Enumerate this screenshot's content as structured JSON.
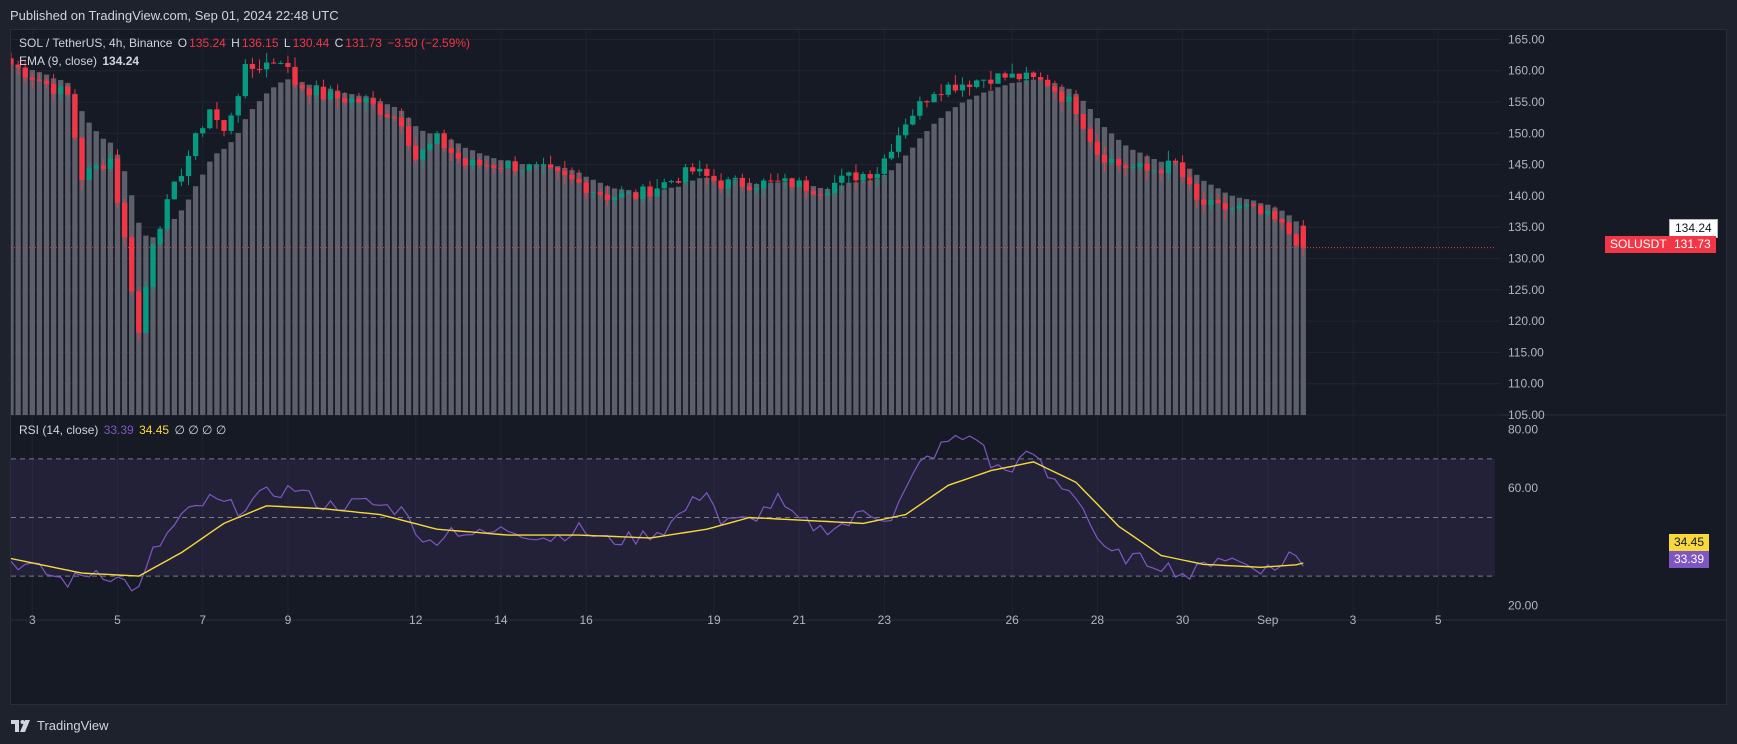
{
  "header": {
    "published": "Published on TradingView.com, Sep 01, 2024 22:48 UTC"
  },
  "footer": {
    "brand": "TradingView"
  },
  "legend": {
    "symbol": "SOL / TetherUS, 4h, Binance",
    "o_label": "O",
    "o_value": "135.24",
    "h_label": "H",
    "h_value": "136.15",
    "l_label": "L",
    "l_value": "130.44",
    "c_label": "C",
    "c_value": "131.73",
    "change": "−3.50 (−2.59%)",
    "ema_label": "EMA (9, close)",
    "ema_value": "134.24",
    "rsi_label": "RSI (14, close)",
    "rsi_value": "33.39",
    "rsi_ma_value": "34.45",
    "rsi_extra": "∅ ∅ ∅ ∅"
  },
  "price_labels": {
    "ema_box": "134.24",
    "symbol_box": "SOLUSDT",
    "last_price_box": "131.73",
    "rsi_ma_box": "34.45",
    "rsi_box": "33.39"
  },
  "colors": {
    "up": "#089981",
    "down": "#f23645",
    "ema_hist": "#5d606b",
    "rsi": "#7e57c2",
    "rsi_ma": "#f7d93d",
    "background": "#161a25"
  },
  "chart_data": [
    {
      "type": "candlestick",
      "title": "SOL / TetherUS, 4h, Binance",
      "y_ticks": [
        "165.00",
        "160.00",
        "155.00",
        "150.00",
        "145.00",
        "140.00",
        "135.00",
        "130.00",
        "125.00",
        "120.00",
        "115.00",
        "110.00",
        "105.00"
      ],
      "ylim": [
        105,
        166.5
      ],
      "x_tick_labels": [
        "3",
        "5",
        "7",
        "9",
        "12",
        "14",
        "16",
        "19",
        "21",
        "23",
        "26",
        "28",
        "30",
        "Sep",
        "3",
        "5"
      ],
      "x_tick_index": [
        3,
        15,
        27,
        39,
        57,
        69,
        81,
        99,
        111,
        123,
        141,
        153,
        165,
        177,
        189,
        201
      ],
      "x_label_index_range": [
        0,
        209
      ],
      "candle_count": 183,
      "ohlc_anchors": [
        [
          0,
          161
        ],
        [
          8,
          156
        ],
        [
          10,
          143
        ],
        [
          14,
          146
        ],
        [
          16,
          133
        ],
        [
          18,
          118
        ],
        [
          20,
          133
        ],
        [
          24,
          144
        ],
        [
          28,
          154
        ],
        [
          30,
          150
        ],
        [
          33,
          160
        ],
        [
          38,
          162
        ],
        [
          40,
          158
        ],
        [
          44,
          156
        ],
        [
          50,
          155
        ],
        [
          55,
          152
        ],
        [
          57,
          146
        ],
        [
          60,
          149
        ],
        [
          64,
          145
        ],
        [
          70,
          145
        ],
        [
          75,
          144
        ],
        [
          80,
          142
        ],
        [
          84,
          140
        ],
        [
          88,
          140
        ],
        [
          92,
          142
        ],
        [
          96,
          144
        ],
        [
          100,
          142
        ],
        [
          104,
          142
        ],
        [
          110,
          142
        ],
        [
          114,
          141
        ],
        [
          118,
          143
        ],
        [
          122,
          144
        ],
        [
          126,
          152
        ],
        [
          130,
          157
        ],
        [
          134,
          158
        ],
        [
          138,
          159
        ],
        [
          142,
          159
        ],
        [
          146,
          158
        ],
        [
          150,
          154
        ],
        [
          153,
          147
        ],
        [
          156,
          145
        ],
        [
          160,
          144
        ],
        [
          164,
          145
        ],
        [
          167,
          139
        ],
        [
          170,
          138
        ],
        [
          174,
          138
        ],
        [
          178,
          136
        ],
        [
          182,
          132
        ]
      ],
      "last": {
        "open": 135.24,
        "high": 136.15,
        "low": 130.44,
        "close": 131.73
      },
      "series": [
        {
          "name": "EMA (9, close)",
          "style": "histogram",
          "last_value": 134.24
        }
      ]
    },
    {
      "type": "line",
      "title": "RSI (14, close)",
      "y_ticks": [
        "80.00",
        "60.00",
        "20.00"
      ],
      "ylim": [
        15,
        85
      ],
      "bands": [
        70,
        50,
        30
      ],
      "series": [
        {
          "name": "RSI",
          "last_value": 33.39,
          "anchors": [
            [
              0,
              35
            ],
            [
              4,
              32
            ],
            [
              8,
              28
            ],
            [
              12,
              32
            ],
            [
              16,
              28
            ],
            [
              18,
              25
            ],
            [
              20,
              38
            ],
            [
              24,
              50
            ],
            [
              28,
              56
            ],
            [
              32,
              53
            ],
            [
              36,
              58
            ],
            [
              40,
              60
            ],
            [
              44,
              54
            ],
            [
              50,
              55
            ],
            [
              56,
              52
            ],
            [
              58,
              40
            ],
            [
              62,
              46
            ],
            [
              66,
              44
            ],
            [
              70,
              46
            ],
            [
              76,
              43
            ],
            [
              80,
              46
            ],
            [
              84,
              42
            ],
            [
              88,
              43
            ],
            [
              92,
              46
            ],
            [
              96,
              55
            ],
            [
              98,
              60
            ],
            [
              100,
              48
            ],
            [
              104,
              49
            ],
            [
              108,
              56
            ],
            [
              110,
              50
            ],
            [
              114,
              46
            ],
            [
              118,
              48
            ],
            [
              120,
              52
            ],
            [
              124,
              50
            ],
            [
              128,
              68
            ],
            [
              132,
              76
            ],
            [
              136,
              78
            ],
            [
              138,
              68
            ],
            [
              140,
              66
            ],
            [
              144,
              72
            ],
            [
              146,
              64
            ],
            [
              150,
              58
            ],
            [
              152,
              48
            ],
            [
              154,
              38
            ],
            [
              158,
              36
            ],
            [
              162,
              34
            ],
            [
              166,
              30
            ],
            [
              170,
              37
            ],
            [
              174,
              34
            ],
            [
              178,
              32
            ],
            [
              180,
              38
            ],
            [
              182,
              34
            ]
          ]
        },
        {
          "name": "RSI-based MA",
          "last_value": 34.45,
          "anchors": [
            [
              0,
              36
            ],
            [
              10,
              31
            ],
            [
              18,
              30
            ],
            [
              24,
              38
            ],
            [
              30,
              48
            ],
            [
              36,
              54
            ],
            [
              44,
              53
            ],
            [
              52,
              51
            ],
            [
              60,
              46
            ],
            [
              70,
              44
            ],
            [
              80,
              44
            ],
            [
              90,
              43
            ],
            [
              98,
              46
            ],
            [
              104,
              50
            ],
            [
              112,
              49
            ],
            [
              120,
              48
            ],
            [
              126,
              51
            ],
            [
              132,
              61
            ],
            [
              138,
              66
            ],
            [
              144,
              69
            ],
            [
              150,
              62
            ],
            [
              156,
              47
            ],
            [
              162,
              37
            ],
            [
              168,
              34
            ],
            [
              176,
              33
            ],
            [
              182,
              34
            ]
          ]
        }
      ]
    }
  ]
}
